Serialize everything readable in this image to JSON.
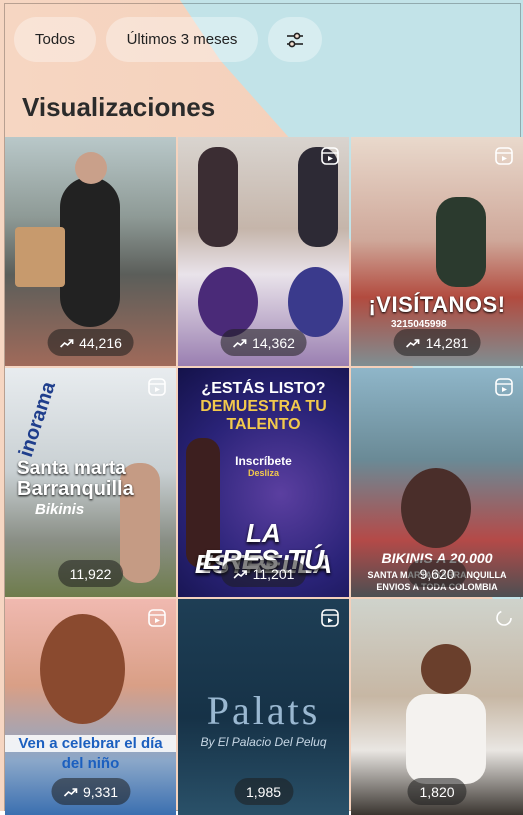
{
  "filters": {
    "todos_label": "Todos",
    "range_label": "Últimos 3 meses",
    "tune_icon": "sliders-icon"
  },
  "section": {
    "title": "Visualizaciones"
  },
  "posts": [
    {
      "views": "44,216",
      "trend_icon": "trend-up-icon"
    },
    {
      "views": "14,362",
      "trend_icon": "trend-up-icon",
      "reel_icon": "reel-icon"
    },
    {
      "views": "14,281",
      "trend_icon": "trend-up-icon",
      "reel_icon": "reel-icon",
      "overlay": {
        "text": "¡VISÍTANOS!",
        "phone": "3215045998"
      }
    },
    {
      "views": "11,922",
      "reel_icon": "reel-icon",
      "overlay": {
        "brand": "inorama",
        "line1": "Santa marta",
        "line2": "Barranquilla",
        "line3": "Bikinis"
      }
    },
    {
      "views": "11,201",
      "trend_icon": "trend-up-icon",
      "overlay": {
        "line1": "¿ESTÁS LISTO?",
        "line2": "DEMUESTRA TU",
        "line3": "TALENTO",
        "line4": "Inscríbete",
        "line5": "Desliza",
        "line6": "LA ESTRELLA",
        "line7": "ERES TÚ"
      }
    },
    {
      "views": "9,620",
      "reel_icon": "reel-icon",
      "overlay": {
        "line1": "BIKINIS A 20.000",
        "line2": "SANTA MARTA BARRANQUILLA",
        "line3": "ENVIOS A TODA COLOMBIA"
      }
    },
    {
      "views": "9,331",
      "trend_icon": "trend-up-icon",
      "reel_icon": "reel-icon",
      "overlay": {
        "line1": "Ven a celebrar el día",
        "line2": "del niño"
      }
    },
    {
      "views": "1,985",
      "reel_icon": "reel-icon",
      "overlay": {
        "line1": "Palats",
        "line2": "By El Palacio Del Peluq"
      }
    },
    {
      "views": "1,820",
      "pin_icon": "loading-icon"
    }
  ],
  "colors": {
    "peach_bg": "#f3cdb7",
    "teal_bg": "#bfe4ea",
    "badge_bg": "#1e1e1e"
  }
}
